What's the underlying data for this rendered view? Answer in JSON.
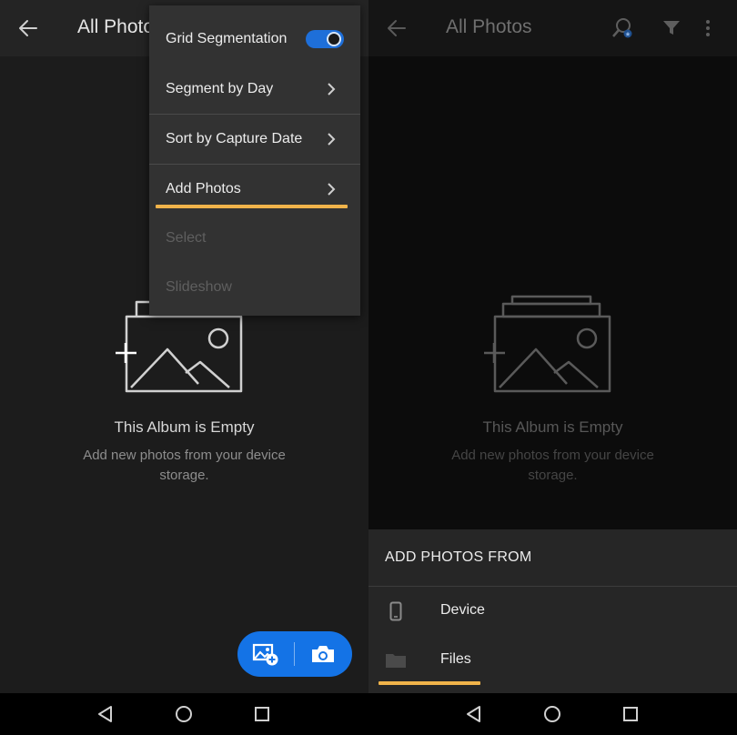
{
  "left_screen": {
    "app_bar": {
      "back_icon": "arrow-left-icon",
      "title": "All Photos"
    },
    "empty_state": {
      "illustration_icon": "add-photo-album-icon",
      "title": "This Album is Empty",
      "subtitle": "Add new photos from your device storage."
    },
    "overflow_menu": {
      "items": [
        {
          "label": "Grid Segmentation",
          "control": "toggle",
          "toggle_on": true
        },
        {
          "label": "Segment by Day",
          "control": "chevron"
        },
        {
          "label": "Sort by Capture Date",
          "control": "chevron"
        },
        {
          "label": "Add Photos",
          "control": "chevron",
          "highlighted": true
        },
        {
          "label": "Select",
          "disabled": true
        },
        {
          "label": "Slideshow",
          "disabled": true
        }
      ]
    },
    "fab": {
      "add_photo_icon": "add-photo-icon",
      "camera_icon": "camera-icon"
    }
  },
  "right_screen": {
    "app_bar": {
      "back_icon": "arrow-left-icon",
      "title": "All Photos",
      "search_icon": "people-search-icon",
      "filter_icon": "filter-icon",
      "more_icon": "more-vertical-icon"
    },
    "empty_state": {
      "illustration_icon": "add-photo-album-icon",
      "title": "This Album is Empty",
      "subtitle": "Add new photos from your device storage."
    },
    "bottom_sheet": {
      "title": "ADD PHOTOS FROM",
      "items": [
        {
          "label": "Device",
          "icon": "phone-icon"
        },
        {
          "label": "Files",
          "icon": "folder-icon",
          "highlighted": true
        }
      ]
    }
  },
  "nav_bar": {
    "back_icon": "nav-back-triangle-icon",
    "home_icon": "nav-home-circle-icon",
    "recents_icon": "nav-recents-square-icon"
  },
  "colors": {
    "accent_blue": "#1473e6",
    "highlight_orange": "#f0b34a",
    "menu_bg": "#323232",
    "sheet_bg": "#262626"
  }
}
